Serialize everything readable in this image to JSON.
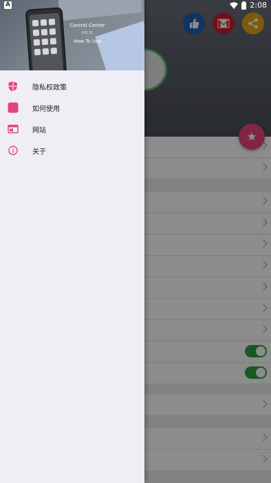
{
  "status_bar": {
    "left_badge": "A",
    "time": "2:08",
    "icons": [
      "wifi-icon",
      "battery-icon"
    ]
  },
  "header_actions": {
    "icons": [
      "thumbs-up-icon",
      "mail-icon",
      "share-icon"
    ],
    "colors": {
      "like": "#1f5fb3",
      "mail": "#c8212a",
      "share": "#e4a51b"
    }
  },
  "fab": {
    "icon": "star-icon",
    "color": "#e7457a"
  },
  "drawer": {
    "header": {
      "promo_title": "Control Center",
      "promo_subtitle": "iOS 11",
      "promo_caption": "How To Use"
    },
    "items": [
      {
        "label": "隐私权政策",
        "icon": "shield-icon"
      },
      {
        "label": "如何使用",
        "icon": "square-icon"
      },
      {
        "label": "网站",
        "icon": "website-icon"
      },
      {
        "label": "关于",
        "icon": "info-icon"
      }
    ],
    "accent_color": "#e7457a"
  },
  "settings_list": {
    "toggle_color": "#2ea043"
  }
}
